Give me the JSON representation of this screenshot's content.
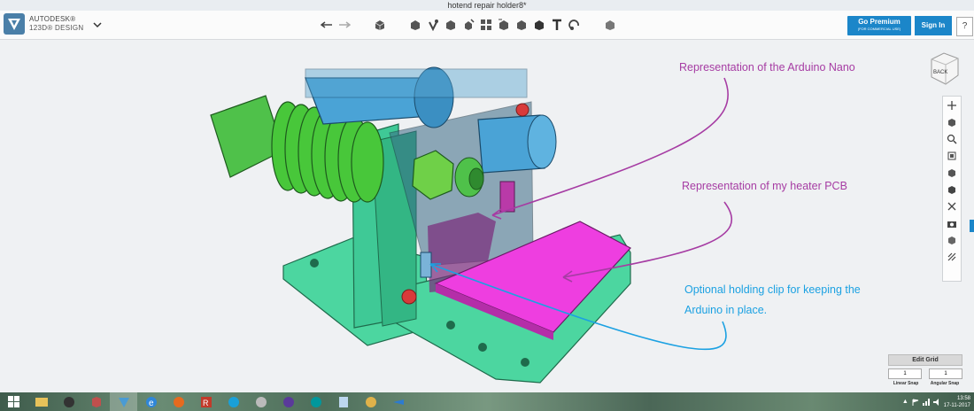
{
  "window": {
    "title": "hotend repair holder8*"
  },
  "app": {
    "brand_line1": "AUTODESK®",
    "brand_line2": "123D® DESIGN"
  },
  "toolbar": {
    "icons": [
      "undo-icon",
      "redo-icon",
      "primitives-icon",
      "sketch-icon",
      "construct-icon",
      "modify-icon",
      "pattern-icon",
      "grouping-icon",
      "combine-icon",
      "measure-icon",
      "text-icon",
      "snap-icon",
      "material-icon"
    ]
  },
  "header": {
    "premium_label": "Go Premium",
    "premium_sub": "(FOR COMMERCIAL USE)",
    "signin_label": "Sign In",
    "help_label": "?"
  },
  "viewcube": {
    "face_label": "BACK"
  },
  "annotations": {
    "arduino": "Representation of the Arduino Nano",
    "heater": "Representation of my heater PCB",
    "clip_line1": "Optional holding clip for keeping the",
    "clip_line2": "Arduino in place."
  },
  "colors": {
    "purple_annotation": "#a63ca3",
    "blue_annotation": "#1ba1e2",
    "accent": "#1b86c9"
  },
  "grid": {
    "title": "Edit Grid",
    "linear_value": "1",
    "angular_value": "1",
    "linear_label": "Linear Snap",
    "angular_label": "Angular Snap"
  },
  "taskbar": {
    "icons": [
      "windows-start-icon",
      "file-explorer-icon",
      "app-icon",
      "app-icon-2",
      "autodesk-123d-icon",
      "internet-explorer-icon",
      "firefox-icon",
      "r-app-icon",
      "c-app-icon",
      "g-app-icon",
      "p-app-icon",
      "arduino-icon",
      "notepad-icon",
      "paint-icon",
      "app-icon-3"
    ],
    "time": "13:58",
    "date": "17-11-2017"
  }
}
